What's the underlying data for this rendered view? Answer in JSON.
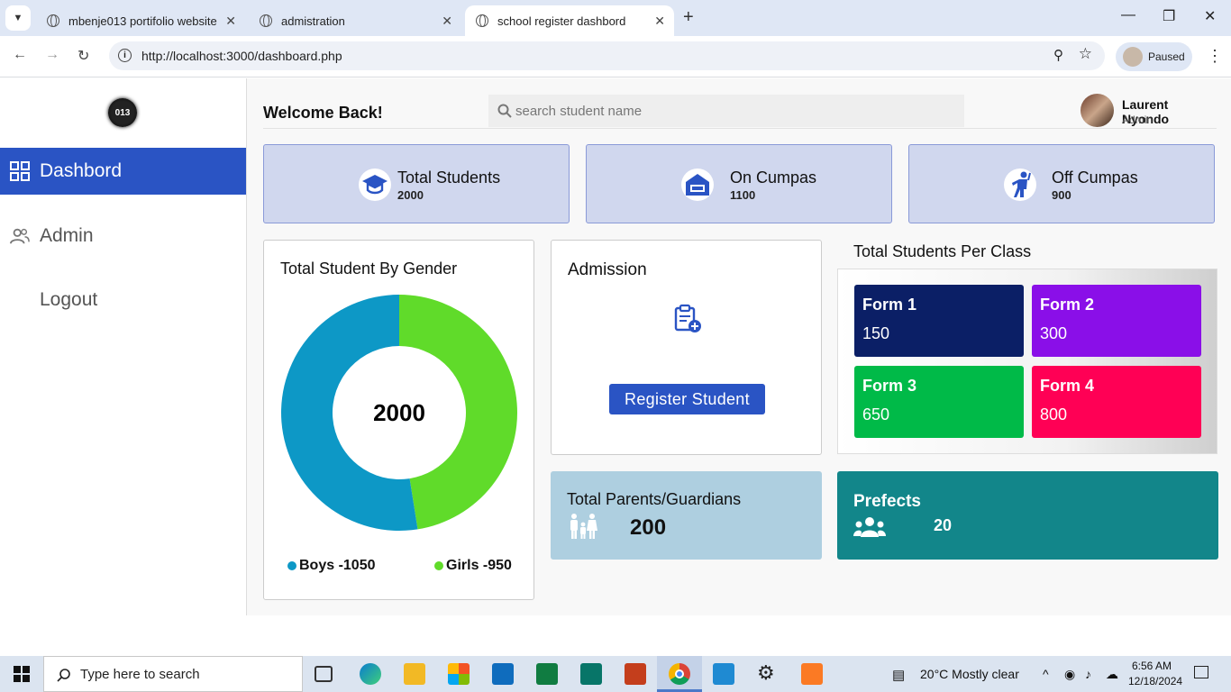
{
  "browser": {
    "tabs": [
      {
        "title": "mbenje013 portifolio website"
      },
      {
        "title": "admistration"
      },
      {
        "title": "school register dashbord"
      }
    ],
    "url": "http://localhost:3000/dashboard.php",
    "profile_status": "Paused"
  },
  "sidebar": {
    "logo_text": "013",
    "items": [
      {
        "label": "Dashbord"
      },
      {
        "label": "Admin"
      },
      {
        "label": "Logout"
      }
    ]
  },
  "header": {
    "welcome": "Welcome Back!",
    "search_placeholder": "search student name",
    "user_name": "Laurent Nyondo",
    "user_role": "Admin"
  },
  "stats": [
    {
      "label": "Total Students",
      "value": "2000",
      "icon": "graduation-cap-icon"
    },
    {
      "label": "On Cumpas",
      "value": "1100",
      "icon": "dormitory-icon"
    },
    {
      "label": "Off Cumpas",
      "value": "900",
      "icon": "walking-person-icon"
    }
  ],
  "gender_card": {
    "title": "Total Student By Gender",
    "center_value": "2000",
    "legend": [
      {
        "label": "Boys -1050",
        "color": "#0d98c6"
      },
      {
        "label": "Girls -950",
        "color": "#60db2a"
      }
    ]
  },
  "chart_data": {
    "type": "pie",
    "categories": [
      "Boys",
      "Girls"
    ],
    "values": [
      1050,
      950
    ],
    "colors": [
      "#0d98c6",
      "#60db2a"
    ],
    "title": "Total Student By Gender",
    "donut": true
  },
  "admission": {
    "title": "Admission",
    "button_label": "Register Student"
  },
  "classes": {
    "title": "Total Students Per Class",
    "items": [
      {
        "name": "Form 1",
        "value": "150",
        "color": "#0b1f66"
      },
      {
        "name": "Form 2",
        "value": "300",
        "color": "#8a0fe8"
      },
      {
        "name": "Form 3",
        "value": "650",
        "color": "#00ba48"
      },
      {
        "name": "Form 4",
        "value": "800",
        "color": "#ff0055"
      }
    ]
  },
  "parents": {
    "title": "Total Parents/Guardians",
    "value": "200"
  },
  "prefects": {
    "title": "Prefects",
    "value": "20"
  },
  "taskbar": {
    "search_placeholder": "Type here to search",
    "weather": "20°C  Mostly clear",
    "time": "6:56 AM",
    "date": "12/18/2024"
  }
}
